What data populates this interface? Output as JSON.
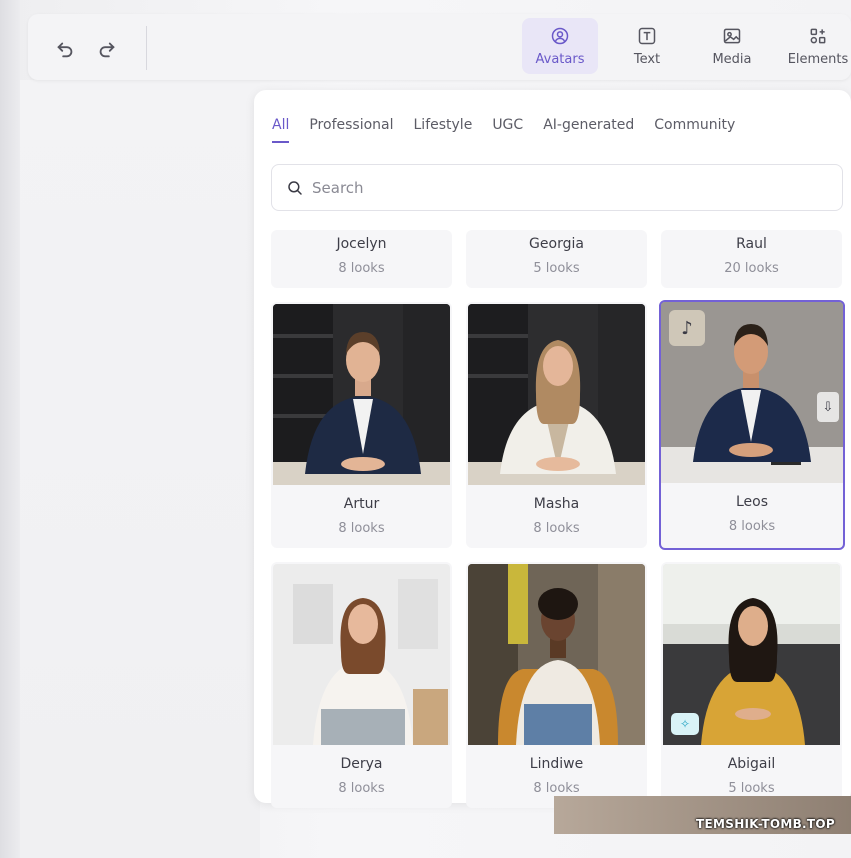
{
  "toolbar": {
    "undo_icon": "undo-icon",
    "redo_icon": "redo-icon",
    "tools": [
      {
        "label": "Avatars",
        "icon": "avatar-icon",
        "active": true
      },
      {
        "label": "Text",
        "icon": "text-icon",
        "active": false
      },
      {
        "label": "Media",
        "icon": "image-icon",
        "active": false
      },
      {
        "label": "Elements",
        "icon": "shapes-icon",
        "active": false
      }
    ]
  },
  "panel": {
    "tabs": [
      "All",
      "Professional",
      "Lifestyle",
      "UGC",
      "AI-generated",
      "Community"
    ],
    "active_tab": "All",
    "search": {
      "placeholder": "Search"
    },
    "avatars": [
      {
        "name": "Jocelyn",
        "looks": "8 looks"
      },
      {
        "name": "Georgia",
        "looks": "5 looks"
      },
      {
        "name": "Raul",
        "looks": "20 looks"
      },
      {
        "name": "Artur",
        "looks": "8 looks"
      },
      {
        "name": "Masha",
        "looks": "8 looks"
      },
      {
        "name": "Leos",
        "looks": "8 looks",
        "selected": true
      },
      {
        "name": "Derya",
        "looks": "8 looks"
      },
      {
        "name": "Lindiwe",
        "looks": "8 looks"
      },
      {
        "name": "Abigail",
        "looks": "5 looks"
      }
    ]
  },
  "watermark": "TEMSHIK-TOMB.TOP",
  "colors": {
    "accent": "#6a59c9",
    "selected_border": "#7361d6"
  }
}
